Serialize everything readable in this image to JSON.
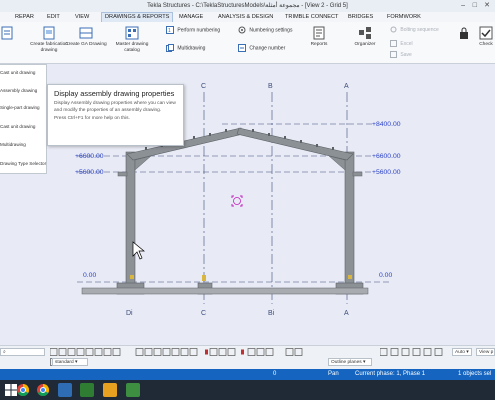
{
  "window": {
    "title": "Tekla Structures - C:\\TeklaStructuresModels\\مجموعة أمثلة - [View 2 - Grid 5]"
  },
  "tabs": [
    {
      "label": "REPAR"
    },
    {
      "label": "EDIT"
    },
    {
      "label": "VIEW"
    },
    {
      "label": "DRAWINGS & REPORTS"
    },
    {
      "label": "MANAGE"
    },
    {
      "label": "ANALYSIS & DESIGN"
    },
    {
      "label": "TRIMBLE CONNECT"
    },
    {
      "label": "BRIDGES"
    },
    {
      "label": "FORMWORK"
    }
  ],
  "ribbon": {
    "create_fabrication_drawing": "Create fabrication drawing",
    "create_ga_drawing": "Create GA Drawing",
    "master_drawing_catalog": "Master drawing catalog",
    "perform_numbering": "Perform numbering",
    "numbering_settings": "Numbering settings",
    "multidrawing": "Multidrawing",
    "change_number": "Change number",
    "reports": "Reports",
    "organizer": "Organizer",
    "bolting_sequence": "Bolting sequence",
    "excel": "Excel",
    "save": "Save",
    "check": "Check"
  },
  "left_menu": {
    "items": [
      "Cast unit drawing",
      "Assembly drawing",
      "Single-part drawing",
      "Cast unit drawing",
      "Multidrawing",
      "Drawing Type Selector"
    ]
  },
  "tooltip": {
    "title": "Display assembly drawing properties",
    "body": "Display Assembly drawing properties where you can view and modify the properties of an assembly drawing.",
    "hint": "Press Ctrl+F1 for more help on this."
  },
  "drawing": {
    "grid_top": [
      "C",
      "B",
      "A"
    ],
    "grid_bottom": [
      "Di",
      "C",
      "Bi",
      "A"
    ],
    "levels": {
      "top": "+8400.00",
      "upper": "+6600.00",
      "mid": "+5600.00",
      "ground": "0.00"
    }
  },
  "bottom_toolbar": {
    "standard": "standard",
    "outline_planes": "Outline planes",
    "auto": "Auto",
    "view_plane": "View p"
  },
  "status_bar": {
    "zero": "0",
    "pan": "Pan",
    "phase": "Current phase: 1, Phase 1",
    "selected": "1 objects sel"
  },
  "colors": {
    "accent": "#1565c0",
    "canvas": "#e8eaf5",
    "steel": "#6e7378",
    "level_text": "#2c44c8",
    "grid_line": "#3c4d7a",
    "selection": "#c020c0"
  }
}
